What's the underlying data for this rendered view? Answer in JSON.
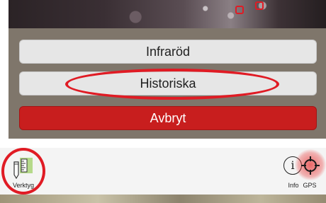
{
  "sheet": {
    "buttons": [
      {
        "label": "Infraröd"
      },
      {
        "label": "Historiska"
      }
    ],
    "cancel_label": "Avbryt"
  },
  "toolbar": {
    "left_tools": [
      {
        "label": "Verktyg",
        "icon": "ruler-pencil-icon"
      }
    ],
    "right_tools": [
      {
        "label": "Info",
        "icon": "info-icon"
      },
      {
        "label": "GPS",
        "icon": "crosshair-icon",
        "active": true
      }
    ]
  },
  "colors": {
    "cancel_button": "#c81e1e",
    "highlight": "#e01b24",
    "overlay": "#7f766b",
    "gps_active_glow": "#e83838"
  }
}
